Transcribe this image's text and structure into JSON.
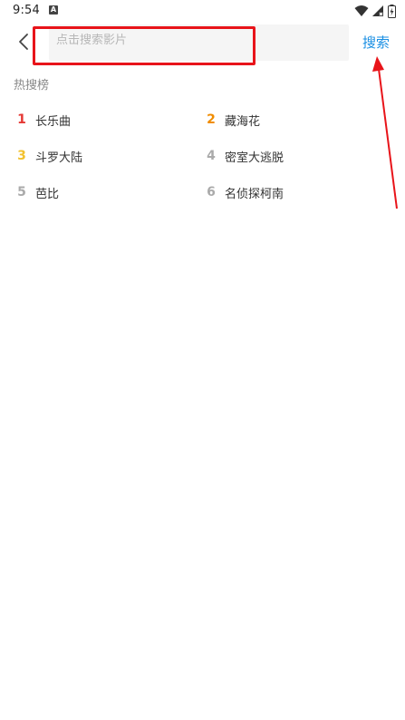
{
  "status_bar": {
    "time": "9:54",
    "notification_icon": "A"
  },
  "header": {
    "search_placeholder": "点击搜索影片",
    "search_value": "",
    "search_button_label": "搜索"
  },
  "hot": {
    "title": "热搜榜",
    "items": [
      {
        "rank": "1",
        "name": "长乐曲",
        "rank_color": "#e53935"
      },
      {
        "rank": "2",
        "name": "藏海花",
        "rank_color": "#f08c00"
      },
      {
        "rank": "3",
        "name": "斗罗大陆",
        "rank_color": "#f2c12e"
      },
      {
        "rank": "4",
        "name": "密室大逃脱",
        "rank_color": "#aaaaaa"
      },
      {
        "rank": "5",
        "name": "芭比",
        "rank_color": "#aaaaaa"
      },
      {
        "rank": "6",
        "name": "名侦探柯南",
        "rank_color": "#aaaaaa"
      }
    ]
  },
  "colors": {
    "accent": "#1a8fe3",
    "annotation": "#e8141a"
  }
}
